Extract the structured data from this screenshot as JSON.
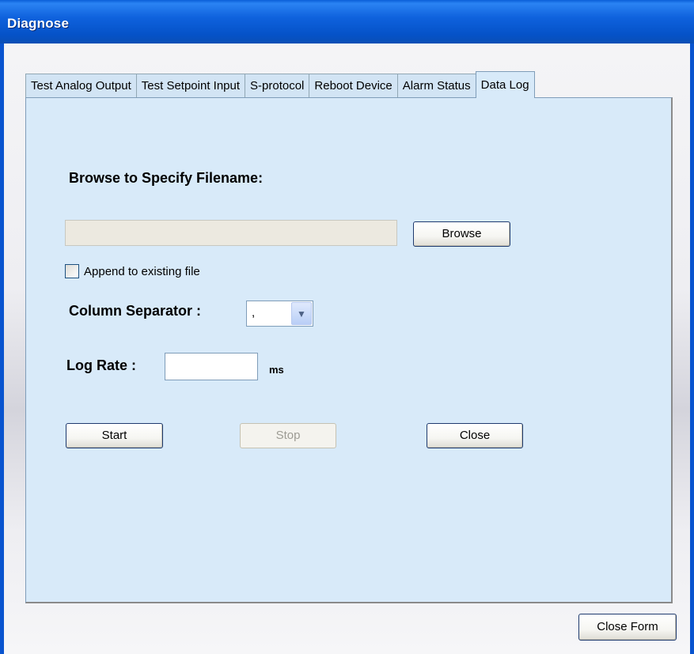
{
  "window": {
    "title": "Diagnose"
  },
  "tabs": [
    {
      "label": "Test Analog Output",
      "active": false
    },
    {
      "label": "Test Setpoint Input",
      "active": false
    },
    {
      "label": "S-protocol",
      "active": false
    },
    {
      "label": "Reboot Device",
      "active": false
    },
    {
      "label": "Alarm Status",
      "active": false
    },
    {
      "label": "Data Log",
      "active": true
    }
  ],
  "data_log": {
    "heading": "Browse to Specify Filename:",
    "filename_value": "",
    "browse_label": "Browse",
    "append_label": "Append to existing file",
    "append_checked": false,
    "separator_label": "Column Separator :",
    "separator_value": ",",
    "log_rate_label": "Log Rate :",
    "log_rate_value": "",
    "log_rate_unit": "ms",
    "start_label": "Start",
    "stop_label": "Stop",
    "stop_enabled": false,
    "close_label": "Close"
  },
  "footer": {
    "close_form_label": "Close Form"
  },
  "icons": {
    "dropdown": "chevron-down-icon"
  },
  "colors": {
    "title_bar": "#0a53d0",
    "panel_bg": "#d8eaf9",
    "frame": "#0954cf"
  }
}
